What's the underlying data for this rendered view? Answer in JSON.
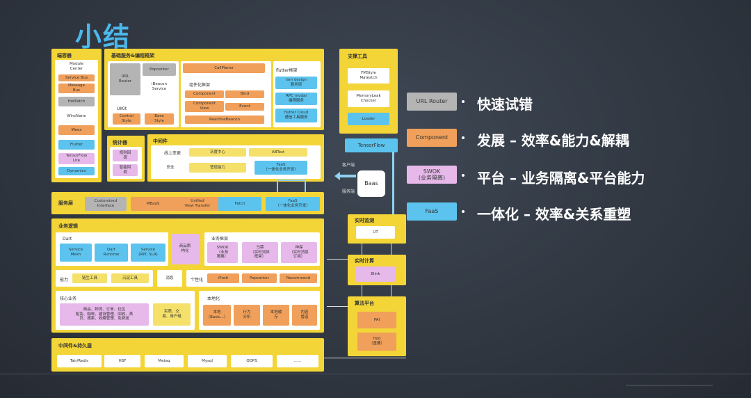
{
  "title": "小结",
  "client": {
    "title": "端容器",
    "items": [
      "Module\nCenter",
      "Service Bus",
      "Message\nBus",
      "HotPatch",
      "WindVane",
      "Weex",
      "Flutter",
      "TensorFlow\nLite",
      "Dynamics"
    ]
  },
  "basic": {
    "title": "基础服务&编程框架",
    "url_router": "URL\nRouter",
    "popcenter": "Popcenter",
    "beacon": "iBeacon\nService",
    "uikit": "UIKit",
    "control_style": "Control\nStyle",
    "base_style": "Base\nStyle",
    "callplanner": "CallPlaner",
    "component_frame": "组件化框架",
    "component": "Component",
    "bind": "Bind",
    "component_view": "Component\nView",
    "event": "Event",
    "reactive": "ReactiveBeacon",
    "flutter_frame": "flutter框架",
    "flutter_items": [
      "tsm design\n服务层",
      "RPC modal\n编程服务",
      "flutter Cloud\n通信工具服务"
    ]
  },
  "support": {
    "title": "支撑工具",
    "items": [
      "FMStyle\nMatestch",
      "MemoryLeak\nChecker",
      "Loader"
    ]
  },
  "tensorflow": "TensorFlow",
  "stats": {
    "title": "统计器",
    "items": [
      "规则回\n调",
      "智能回\n调"
    ]
  },
  "middle": {
    "title": "中间件",
    "online": "线上变更",
    "gray": "灰度中心",
    "abtest": "ABTest",
    "security": "安全",
    "network": "管道能力",
    "faas": "FaaS\n（一体化业务开发）"
  },
  "baas": "Baas",
  "client_label": "客户端",
  "server_label": "服务端",
  "service": {
    "title": "服务层",
    "items": [
      "Customized\nInterface",
      "MBaaS",
      "Unified\nView Transfer",
      "Fetch",
      "FaaS\n（一体化业务开发）"
    ]
  },
  "business": {
    "title": "业务逻辑",
    "dart": "Dart",
    "dart_items": [
      "Service\nMesh",
      "Dart\nRuntime",
      "Service\n(RPC SLA)"
    ],
    "product": "商品质\n构化",
    "biz_frame": "业务框架",
    "biz_items": [
      "SWOK\n（业务\n隔离）",
      "马蹄\n（实时流体\n框架）",
      "神探\n（实时消息\n订阅）"
    ],
    "ability": "能力",
    "ability_items": [
      "链生工具",
      "沉淀工具"
    ],
    "message": "消息",
    "personal": "个性化",
    "personal_items": [
      "iPush",
      "Popcenter",
      "Recommend"
    ],
    "core": "核心业务",
    "core_items": "商品、物流、订单、社区\n租赁、咖啡、建设管理、回收、首\n页、搜索、收藏管理、免费送",
    "core_extra": "实质、交\n易、用户组",
    "local": "本地化",
    "local_items": [
      "本地\n（Basic...）",
      "行为\n分析",
      "本地缓\n存",
      "内容\n管道"
    ]
  },
  "persist": {
    "title": "中间件&持久层",
    "items": [
      "Tair/Redis",
      "HSF",
      "Metaq",
      "Mysql",
      "ODPS",
      "……"
    ]
  },
  "realtime_monitor": {
    "title": "实时监测",
    "item": "UT"
  },
  "realtime_compute": {
    "title": "实时计算",
    "item": "Blink"
  },
  "algo": {
    "title": "算法平台",
    "items": [
      "PAI",
      "Hdd\n（重要）"
    ]
  },
  "legend": [
    {
      "box": "URL Router",
      "color": "#b4b4b4",
      "text": "快速试错"
    },
    {
      "box": "Component",
      "color": "#f0a05a",
      "text": "发展 – 效率&能力&解耦"
    },
    {
      "box": "SWOK\n(业务隔离)",
      "color": "#e6b9ea",
      "text": "平台 – 业务隔离&平台能力"
    },
    {
      "box": "FaaS",
      "color": "#5bc3ee",
      "text": "一体化 – 效率&关系重塑"
    }
  ]
}
